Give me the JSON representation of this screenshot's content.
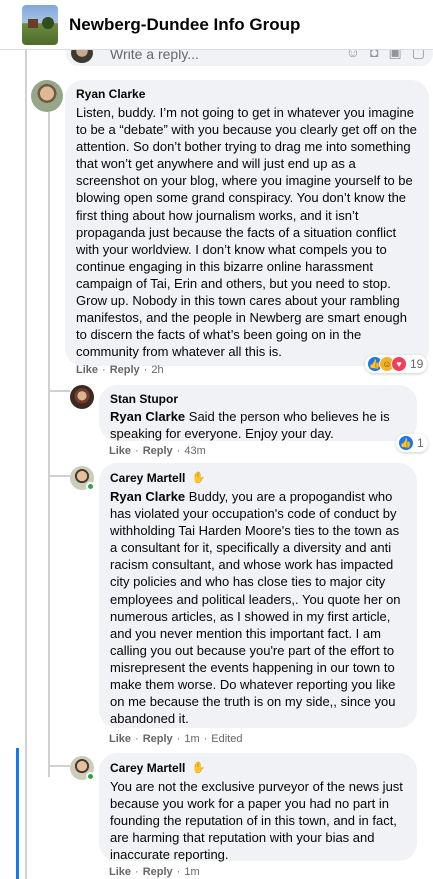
{
  "header": {
    "group_title": "Newberg-Dundee Info Group"
  },
  "reply_bar": {
    "placeholder": "Write a reply..."
  },
  "comments": [
    {
      "author": "Ryan Clarke",
      "text": "Listen, buddy. I’m not going to get in whatever you imagine to be a “debate” with you because you clearly get off on the attention. So don’t bother trying to drag me into something that won’t get anywhere and will just end up as a screenshot on your blog, where you imagine yourself to be blowing open some grand conspiracy. You don’t know the first thing about how journalism works, and it isn’t propaganda just because the facts of a situation conflict with your worldview. I don’t know what compels you to continue engaging in this bizarre online harassment campaign of Tai, Erin and others, but you need to stop. Grow up. Nobody in this town cares about your rambling manifestos, and the people in Newberg are smart enough to discern the facts of what’s been going on in the community from whatever all this is.",
      "like_label": "Like",
      "reply_label": "Reply",
      "time": "2h",
      "reaction_count": "19"
    },
    {
      "author": "Stan Stupor",
      "mention": "Ryan Clarke",
      "text": " Said the person who believes he is speaking for everyone. Enjoy your day.",
      "like_label": "Like",
      "reply_label": "Reply",
      "time": "43m",
      "reaction_count": "1"
    },
    {
      "author": "Carey Martell",
      "mention": "Ryan Clarke",
      "text": " Buddy, you are a propogandist who has violated your occupation's code of conduct by withholding Tai Harden Moore's ties to the town as a consultant for it, specifically a diversity and anti racism consultant, and whose work has impacted city policies and who has close ties to major city employees and political leaders,. You quote her on numerous articles, as I showed in my first article, and you never mention this important fact. I am calling you out because you're part of the effort to misrepresent the events happening in our town to make them worse. Do whatever reporting you like on me because the truth is on my side,, since you abandoned it.",
      "like_label": "Like",
      "reply_label": "Reply",
      "time": "1m",
      "edited_label": "Edited"
    },
    {
      "author": "Carey Martell",
      "text": "You are not the exclusive purveyor of the news just because you work for a paper you had no part in founding the reputation of in this town, and in fact, are harming that reputation with your bias and inaccurate reporting.",
      "like_label": "Like",
      "reply_label": "Reply",
      "time": "1m"
    }
  ],
  "icons": {
    "author_badge": "top-fan-badge-icon",
    "reactions": [
      "like-reaction-icon",
      "haha-reaction-icon",
      "love-reaction-icon"
    ]
  },
  "colors": {
    "bubble": "#f0f2f5",
    "meta_text": "#65676b",
    "like_blue": "#1877f2",
    "love_red": "#f33e58",
    "online_green": "#31a24c"
  }
}
